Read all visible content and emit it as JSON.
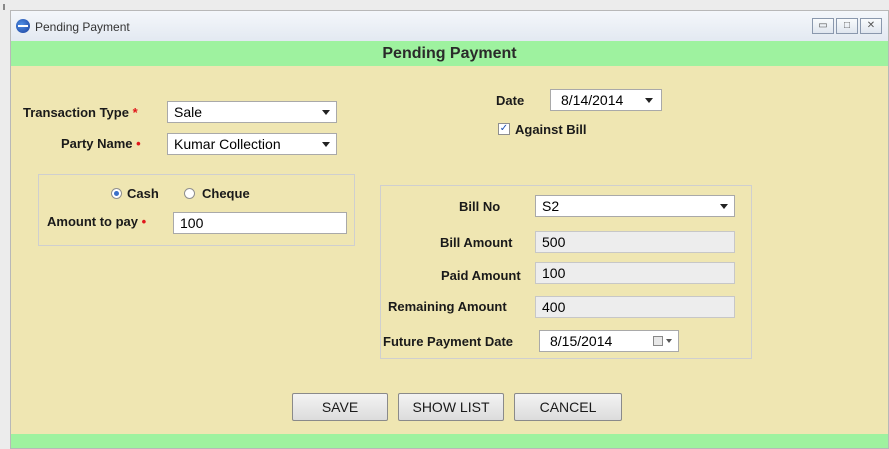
{
  "window": {
    "title": "Pending Payment",
    "controls": [
      "minimize",
      "maximize",
      "close"
    ]
  },
  "form": {
    "heading": "Pending Payment",
    "transaction_type": {
      "label": "Transaction Type",
      "value": "Sale"
    },
    "party_name": {
      "label": "Party Name",
      "value": "Kumar Collection"
    },
    "date": {
      "label": "Date",
      "value": "8/14/2014"
    },
    "against_bill": {
      "label": "Against Bill",
      "checked": true
    },
    "payment_mode": {
      "cash_label": "Cash",
      "cheque_label": "Cheque",
      "selected": "Cash"
    },
    "amount_to_pay": {
      "label": "Amount to pay",
      "value": "100"
    },
    "bill_no": {
      "label": "Bill No",
      "value": "S2"
    },
    "bill_amount": {
      "label": "Bill Amount",
      "value": "500"
    },
    "paid_amount": {
      "label": "Paid Amount",
      "value": "100"
    },
    "remaining_amount": {
      "label": "Remaining Amount",
      "value": "400"
    },
    "future_payment_date": {
      "label": "Future Payment Date",
      "value": "8/15/2014"
    },
    "required_marker": "*",
    "required_dot": "•"
  },
  "buttons": {
    "save": "SAVE",
    "show_list": "SHOW LIST",
    "cancel": "CANCEL"
  },
  "colors": {
    "background": "#efe6b2",
    "band": "#9ef29f",
    "required": "#e0171b"
  }
}
